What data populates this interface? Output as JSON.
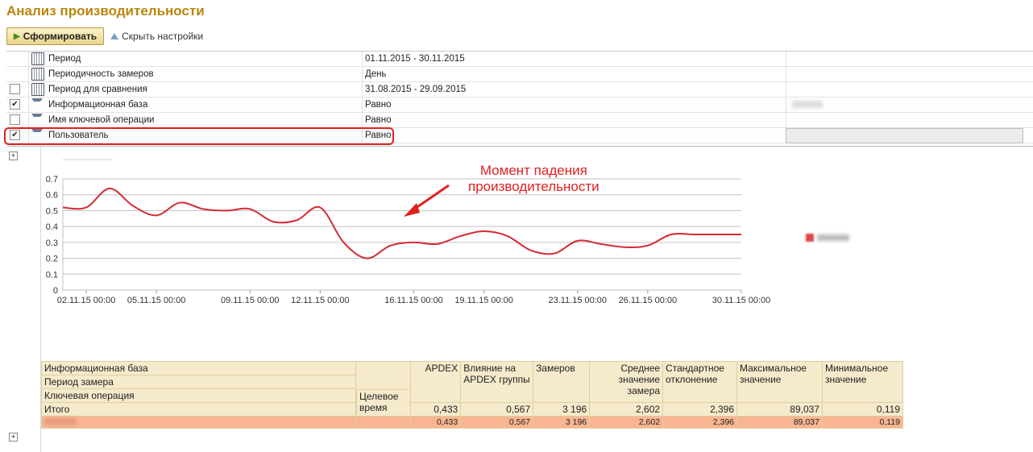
{
  "title": "Анализ производительности",
  "toolbar": {
    "generate_label": "Сформировать",
    "hide_settings_label": "Скрыть настройки"
  },
  "settings": [
    {
      "label": "Период",
      "value": "01.11.2015 - 30.11.2015",
      "checkbox": false,
      "checked": false,
      "icon": "calendar-icon"
    },
    {
      "label": "Периодичность замеров",
      "value": "День",
      "checkbox": false,
      "checked": false,
      "icon": "calendar-icon"
    },
    {
      "label": "Период для сравнения",
      "value": "31.08.2015 - 29.09.2015",
      "checkbox": true,
      "checked": false,
      "icon": "calendar-icon"
    },
    {
      "label": "Информационная база",
      "value": "Равно",
      "checkbox": true,
      "checked": true,
      "icon": "filter-icon"
    },
    {
      "label": "Имя ключевой операции",
      "value": "Равно",
      "checkbox": true,
      "checked": false,
      "icon": "filter-icon"
    },
    {
      "label": "Пользователь",
      "value": "Равно",
      "checkbox": true,
      "checked": true,
      "icon": "filter-icon"
    }
  ],
  "annotation": {
    "line1": "Момент падения",
    "line2": "производительности",
    "color": "#e02020"
  },
  "chart_data": {
    "type": "line",
    "x": [
      "01.11.15",
      "02.11.15",
      "03.11.15",
      "04.11.15",
      "05.11.15",
      "06.11.15",
      "07.11.15",
      "08.11.15",
      "09.11.15",
      "10.11.15",
      "11.11.15",
      "12.11.15",
      "13.11.15",
      "14.11.15",
      "15.11.15",
      "16.11.15",
      "17.11.15",
      "18.11.15",
      "19.11.15",
      "20.11.15",
      "21.11.15",
      "22.11.15",
      "23.11.15",
      "24.11.15",
      "25.11.15",
      "26.11.15",
      "27.11.15",
      "28.11.15",
      "29.11.15",
      "30.11.15"
    ],
    "x_tick_labels": [
      "02.11.15 00:00",
      "05.11.15 00:00",
      "09.11.15 00:00",
      "12.11.15 00:00",
      "16.11.15 00:00",
      "19.11.15 00:00",
      "23.11.15 00:00",
      "26.11.15 00:00",
      "30.11.15 00:00"
    ],
    "series": [
      {
        "values": [
          0.52,
          0.52,
          0.64,
          0.53,
          0.47,
          0.55,
          0.51,
          0.5,
          0.51,
          0.43,
          0.44,
          0.52,
          0.3,
          0.2,
          0.28,
          0.3,
          0.29,
          0.34,
          0.37,
          0.34,
          0.25,
          0.23,
          0.31,
          0.29,
          0.27,
          0.28,
          0.35,
          0.35,
          0.35,
          0.35
        ],
        "color": "#d42a34"
      }
    ],
    "y_ticks": [
      "0",
      "0.1",
      "0.2",
      "0.3",
      "0.4",
      "0.5",
      "0.6",
      "0.7"
    ],
    "ylim": [
      0,
      0.7
    ],
    "grid": true,
    "legend": "right"
  },
  "table": {
    "headers": {
      "group1": "Информационная база",
      "group2": "Период замера",
      "group3": "Ключевая операция",
      "target_time": "Целевое время",
      "apdex": "APDEX",
      "influence": "Влияние на APDEX группы",
      "count": "Замеров",
      "avg": "Среднее значение замера",
      "stddev": "Стандартное отклонение",
      "max": "Максимальное значение",
      "min": "Минимальное значение"
    },
    "total": {
      "label": "Итого",
      "apdex": "0,433",
      "influence": "0,567",
      "count": "3 196",
      "avg": "2,602",
      "stddev": "2,396",
      "max": "89,037",
      "min": "0,119"
    },
    "row": {
      "apdex": "0,433",
      "influence": "0,567",
      "count": "3 196",
      "avg": "2,602",
      "stddev": "2,396",
      "max": "89,037",
      "min": "0,119"
    }
  }
}
